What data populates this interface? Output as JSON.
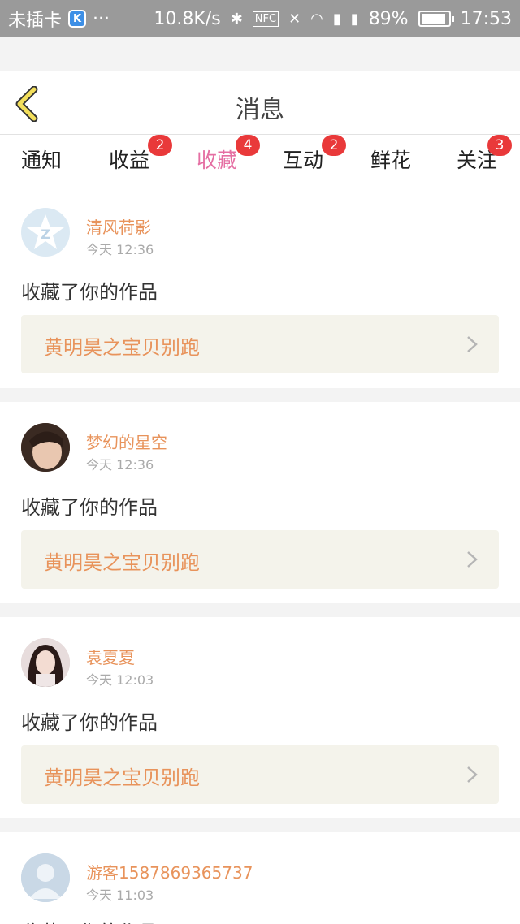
{
  "status": {
    "carrier": "未插卡",
    "k_badge": "K",
    "dots": "···",
    "speed": "10.8K/s",
    "bluetooth": "bluetooth-icon",
    "nfc": "NFC",
    "battery": "89%",
    "time": "17:53"
  },
  "header": {
    "title": "消息"
  },
  "tabs": [
    {
      "label": "通知",
      "badge": ""
    },
    {
      "label": "收益",
      "badge": "2"
    },
    {
      "label": "收藏",
      "badge": "4",
      "active": true
    },
    {
      "label": "互动",
      "badge": "2"
    },
    {
      "label": "鲜花",
      "badge": ""
    },
    {
      "label": "关注",
      "badge": "3"
    }
  ],
  "messages": [
    {
      "user": "清风荷影",
      "time": "今天 12:36",
      "action": "收藏了你的作品",
      "work": "黄明昊之宝贝别跑"
    },
    {
      "user": "梦幻的星空",
      "time": "今天 12:36",
      "action": "收藏了你的作品",
      "work": "黄明昊之宝贝别跑"
    },
    {
      "user": "袁夏夏",
      "time": "今天 12:03",
      "action": "收藏了你的作品",
      "work": "黄明昊之宝贝别跑"
    },
    {
      "user": "游客1587869365737",
      "time": "今天 11:03",
      "action": "收藏了你的作品",
      "work": ""
    }
  ],
  "colors": {
    "accent": "#e56fa3",
    "name": "#e8935b",
    "badge": "#e9393a"
  }
}
